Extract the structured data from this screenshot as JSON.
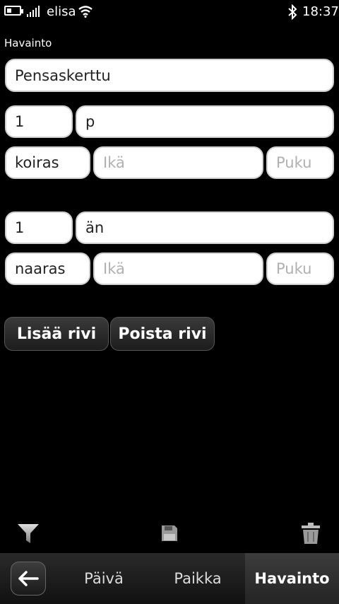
{
  "status_bar": {
    "operator": "elisa",
    "time": "18:37",
    "battery_level": 0.4
  },
  "form": {
    "section_label": "Havainto",
    "species": "Pensaskerttu",
    "rows": [
      {
        "count": "1",
        "code": "p",
        "sex": "koiras",
        "age_placeholder": "Ikä",
        "plumage_placeholder": "Puku"
      },
      {
        "count": "1",
        "code": "än",
        "sex": "naaras",
        "age_placeholder": "Ikä",
        "plumage_placeholder": "Puku"
      }
    ]
  },
  "buttons": {
    "add_row": "Lisää rivi",
    "remove_row": "Poista rivi"
  },
  "toolbar": {
    "icons": [
      "filter-icon",
      "save-icon",
      "trash-icon"
    ]
  },
  "tabs": [
    {
      "label": "Päivä",
      "active": false
    },
    {
      "label": "Paikka",
      "active": false
    },
    {
      "label": "Havainto",
      "active": true
    }
  ],
  "colors": {
    "background": "#000000",
    "field": "#ffffff",
    "placeholder": "#b0b0b0"
  }
}
